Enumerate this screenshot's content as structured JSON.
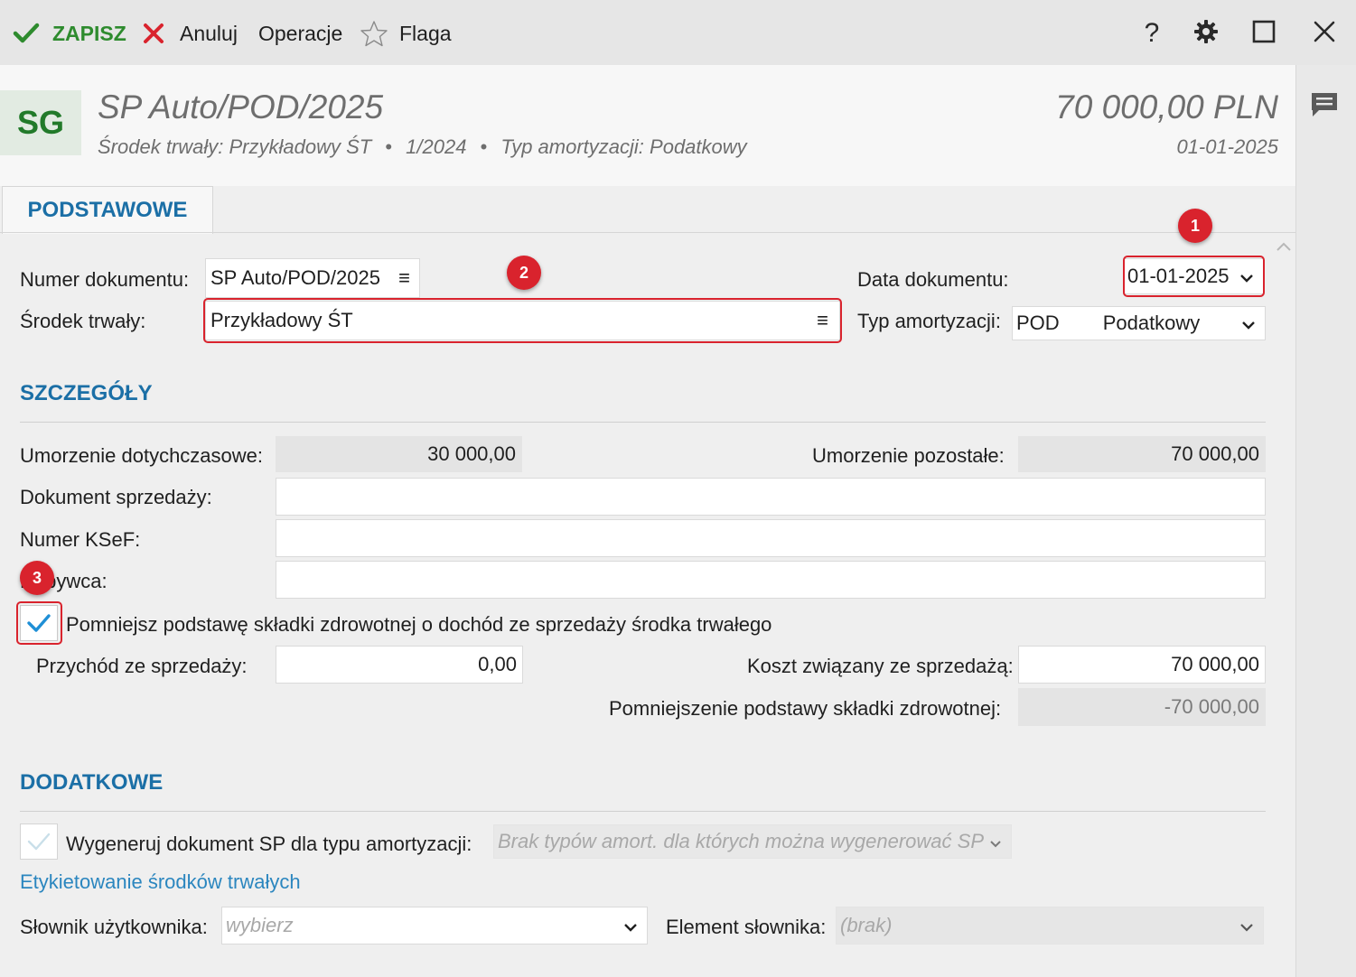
{
  "toolbar": {
    "save_label": "ZAPISZ",
    "cancel_label": "Anuluj",
    "operations_label": "Operacje",
    "flag_label": "Flaga",
    "help_label": "?"
  },
  "header": {
    "badge": "SG",
    "title": "SP Auto/POD/2025",
    "subtitle_asset": "Środek trwały: Przykładowy ŚT",
    "subtitle_sep": "•",
    "subtitle_period": "1/2024",
    "subtitle_type": "Typ amortyzacji: Podatkowy",
    "amount": "70 000,00 PLN",
    "date": "01-01-2025"
  },
  "tabs": [
    {
      "label": "PODSTAWOWE"
    }
  ],
  "basic": {
    "doc_number_label": "Numer dokumentu:",
    "doc_number_value": "SP Auto/POD/2025",
    "asset_label": "Środek trwały:",
    "asset_value": "Przykładowy ŚT",
    "doc_date_label": "Data dokumentu:",
    "doc_date_value": "01-01-2025",
    "amort_type_label": "Typ amortyzacji:",
    "amort_type_code": "POD",
    "amort_type_name": "Podatkowy",
    "menu_glyph": "≡"
  },
  "details": {
    "title": "SZCZEGÓŁY",
    "accum_label": "Umorzenie dotychczasowe:",
    "accum_value": "30 000,00",
    "remaining_label": "Umorzenie pozostałe:",
    "remaining_value": "70 000,00",
    "sale_doc_label": "Dokument sprzedaży:",
    "ksef_label": "Numer KSeF:",
    "buyer_label": "Nabywca:",
    "health_checkbox_label": "Pomniejsz podstawę składki zdrowotnej o dochód ze sprzedaży środka trwałego",
    "health_checked": true,
    "income_label": "Przychód ze sprzedaży:",
    "income_value": "0,00",
    "cost_label": "Koszt związany ze sprzedażą:",
    "cost_value": "70 000,00",
    "reduction_label": "Pomniejszenie podstawy składki zdrowotnej:",
    "reduction_value": "-70 000,00"
  },
  "additional": {
    "title": "DODATKOWE",
    "generate_label": "Wygeneruj dokument SP dla typu amortyzacji:",
    "generate_placeholder": "Brak typów amort. dla których można wygenerować SP",
    "labeling_link": "Etykietowanie środków trwałych",
    "dict_label": "Słownik użytkownika:",
    "dict_placeholder": "wybierz",
    "element_label": "Element słownika:",
    "element_placeholder": "(brak)"
  },
  "annotations": [
    "1",
    "2",
    "3"
  ],
  "colors": {
    "accent": "#1b6fa6",
    "save_green": "#2e8b2e",
    "cancel_red": "#d9232d",
    "marker_red": "#d9232d"
  },
  "icons": [
    "check-icon",
    "x-icon",
    "star-icon",
    "help-icon",
    "gear-icon",
    "maximize-icon",
    "close-icon",
    "comment-icon",
    "chevron-down-icon",
    "chevron-up-icon",
    "menu-icon"
  ]
}
